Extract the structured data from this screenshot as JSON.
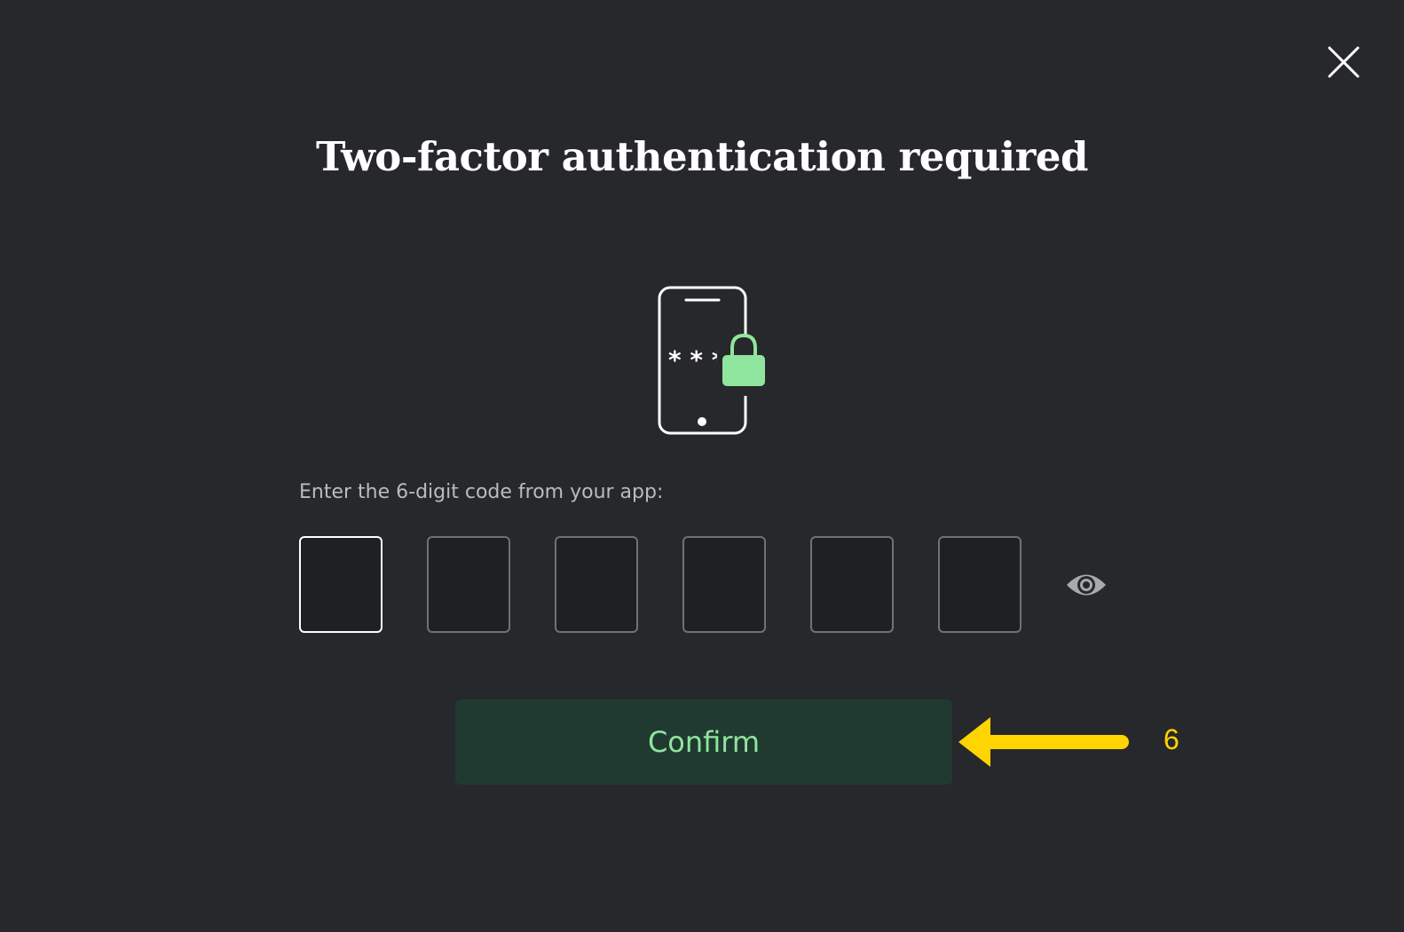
{
  "dialog": {
    "title": "Two-factor authentication required",
    "close_icon": "close-icon",
    "illustration_icon": "phone-lock-icon",
    "instruction": "Enter the 6-digit code from your app:",
    "code_inputs": [
      {
        "value": "",
        "active": true
      },
      {
        "value": "",
        "active": false
      },
      {
        "value": "",
        "active": false
      },
      {
        "value": "",
        "active": false
      },
      {
        "value": "",
        "active": false
      },
      {
        "value": "",
        "active": false
      }
    ],
    "show_code_icon": "eye-icon",
    "confirm_label": "Confirm"
  },
  "annotation": {
    "arrow_icon": "arrow-left-icon",
    "step_number": "6"
  },
  "colors": {
    "background": "#27282b",
    "accent_green": "#8fe59d",
    "confirm_bg": "#213a31",
    "annotation_yellow": "#ffd400"
  }
}
